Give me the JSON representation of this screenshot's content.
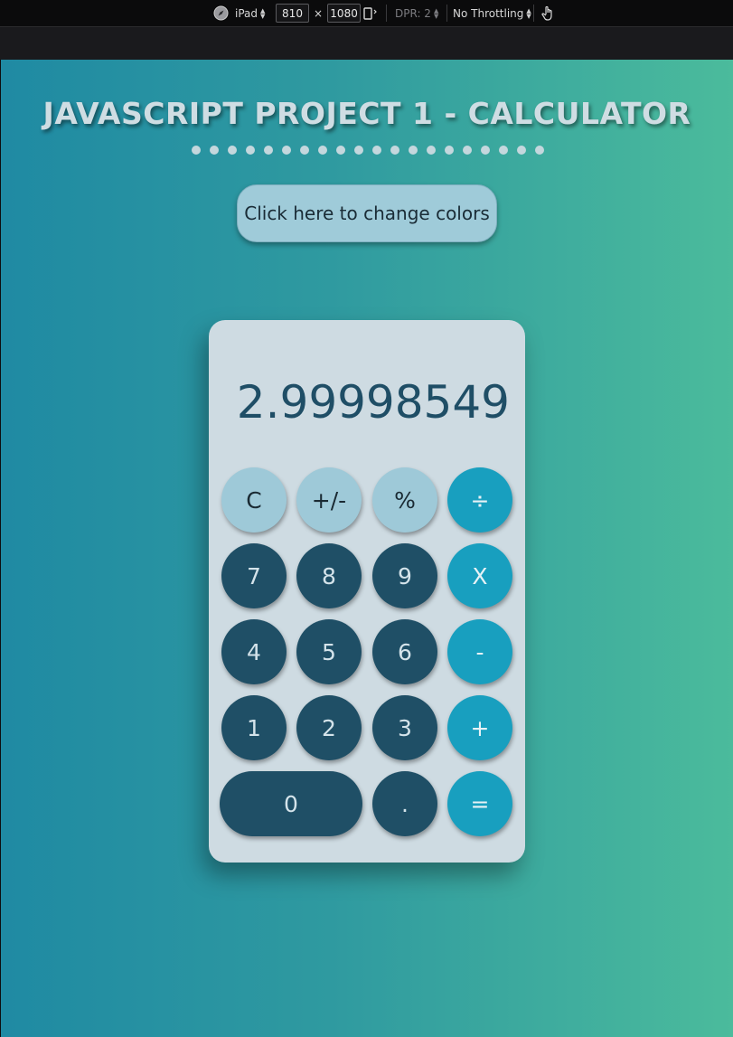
{
  "devtools": {
    "device": "iPad",
    "width": "810",
    "times": "×",
    "height": "1080",
    "dpr": "DPR: 2",
    "throttling": "No Throttling"
  },
  "page": {
    "title": "JAVASCRIPT PROJECT 1 - CALCULATOR",
    "color_button": "Click here to change colors",
    "colors": {
      "gradient_start": "#1f8aa3",
      "gradient_end": "#4bbb9c",
      "accent": "#189fbf",
      "dark_key": "#1f4f66"
    }
  },
  "calculator": {
    "display": "2.99998549",
    "keys": {
      "clear": "C",
      "sign": "+/-",
      "percent": "%",
      "divide": "÷",
      "seven": "7",
      "eight": "8",
      "nine": "9",
      "multiply": "X",
      "four": "4",
      "five": "5",
      "six": "6",
      "minus": "-",
      "one": "1",
      "two": "2",
      "three": "3",
      "plus": "+",
      "zero": "0",
      "dot": ".",
      "equals": "="
    }
  }
}
